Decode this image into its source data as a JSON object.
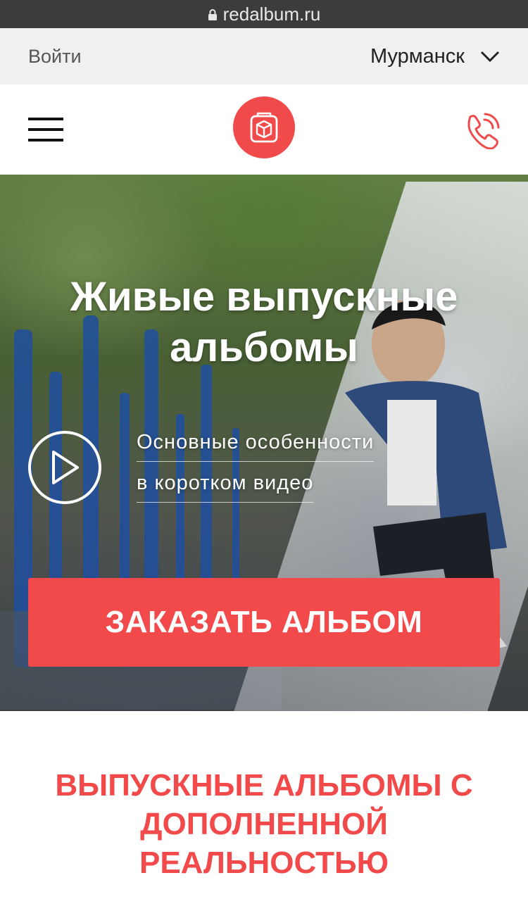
{
  "browser": {
    "url": "redalbum.ru"
  },
  "topbar": {
    "login_label": "Войти",
    "city": "Мурманск"
  },
  "header": {
    "menu_icon": "hamburger-menu-icon",
    "logo_icon": "album-box-logo",
    "phone_icon": "phone-call-icon"
  },
  "hero": {
    "title_line1": "Живые выпускные",
    "title_line2": "альбомы",
    "video_line1": "Основные особенности",
    "video_line2": "в коротком видео",
    "cta_label": "ЗАКАЗАТЬ АЛЬБОМ"
  },
  "section": {
    "title_line1": "ВЫПУСКНЫЕ АЛЬБОМЫ С",
    "title_line2": "ДОПОЛНЕННОЙ",
    "title_line3": "РЕАЛЬНОСТЬЮ"
  },
  "colors": {
    "accent": "#f24a4a",
    "topbar_bg": "#f0f0f0",
    "urlbar_bg": "#3c3c3e"
  }
}
